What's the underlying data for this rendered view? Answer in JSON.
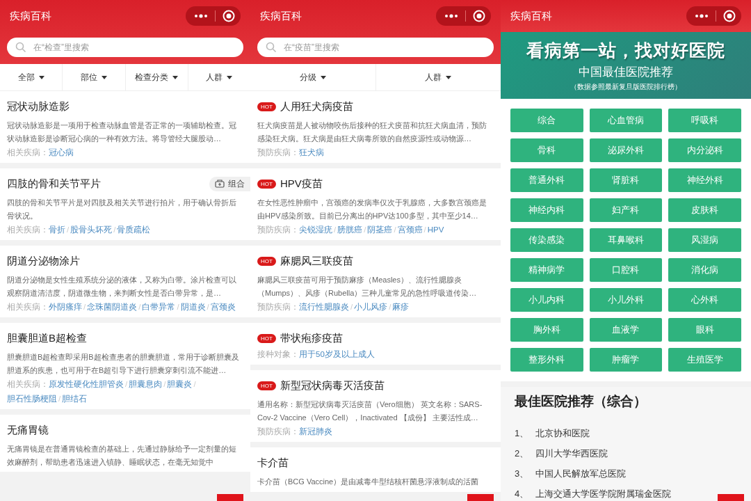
{
  "screens": [
    {
      "kind": "exams",
      "title": "疾病百科",
      "search": {
        "placeholder": "在“检查”里搜索"
      },
      "separator": "/",
      "filters": [
        {
          "label": "全部"
        },
        {
          "label": "部位"
        },
        {
          "label": "检查分类"
        },
        {
          "label": "人群"
        }
      ],
      "items": [
        {
          "title": "冠状动脉造影",
          "description": "冠状动脉造影是一项用于检查动脉血管是否正常的一项辅助检查。冠状动脉造影是诊断冠心病的一种有效方法。将导管经大腿股动…",
          "label": "相关疾病：",
          "related": [
            "冠心病"
          ]
        },
        {
          "title": "四肢的骨和关节平片",
          "tag": "组合",
          "description": "四肢的骨和关节平片是对四肢及相关关节进行拍片，用于确认骨折后骨状况。",
          "label": "相关疾病：",
          "related": [
            "骨折",
            "股骨头坏死",
            "骨质疏松"
          ]
        },
        {
          "title": "阴道分泌物涂片",
          "description": "阴道分泌物是女性生殖系统分泌的液体，又称为白带。涂片检查可以观察阴道清洁度，阴道微生物，来判断女性是否白带异常，是…",
          "label": "相关疾病：",
          "related": [
            "外阴瘙痒",
            "念珠菌阴道炎",
            "白带异常",
            "阴道炎",
            "宫颈炎"
          ]
        },
        {
          "title": "胆囊胆道B超检查",
          "description": "胆囊胆道B超检查即采用B超检查患者的胆囊胆道，常用于诊断胆囊及胆道系的疾患，也可用于在B超引导下进行胆囊穿刺引流不能进…",
          "label": "相关疾病：",
          "related": [
            "原发性硬化性胆管炎",
            "胆囊息肉",
            "胆囊炎",
            "胆石性肠梗阻",
            "胆结石"
          ]
        },
        {
          "title": "无痛胃镜",
          "description": "无痛胃镜是在普通胃镜检查的基础上，先通过静脉给予一定剂量的短效麻醉剂，帮助患者迅速进入镇静、睡眠状态，在毫无知觉中"
        }
      ]
    },
    {
      "kind": "vaccines",
      "title": "疾病百科",
      "search": {
        "placeholder": "在“疫苗”里搜索"
      },
      "separator": "/",
      "filters": [
        {
          "label": "分级"
        },
        {
          "label": "人群"
        }
      ],
      "items": [
        {
          "badge": "HOT",
          "title": "人用狂犬病疫苗",
          "description": "狂犬病疫苗是人被动物咬伤后接种的狂犬疫苗和抗狂犬病血清，预防感染狂犬病。狂犬病是由狂犬病毒所致的自然疫源性或动物源…",
          "label": "预防疾病：",
          "related": [
            "狂犬病"
          ]
        },
        {
          "badge": "HOT",
          "title": "HPV疫苗",
          "description": "在女性恶性肿瘤中，宫颈癌的发病率仅次于乳腺癌，大多数宫颈癌是由HPV感染所致。目前已分离出的HPV达100多型，其中至少14…",
          "label": "预防疾病：",
          "related": [
            "尖锐湿疣",
            "膀胱癌",
            "阴茎癌",
            "宫颈癌",
            "HPV"
          ]
        },
        {
          "badge": "HOT",
          "title": "麻腮风三联疫苗",
          "description": "麻腮风三联疫苗可用于预防麻疹（Measles）、流行性腮腺炎（Mumps）、风疹（Rubella）三种儿童常见的急性呼吸道传染…",
          "label": "预防疾病：",
          "related": [
            "流行性腮腺炎",
            "小儿风疹",
            "麻疹"
          ]
        },
        {
          "badge": "HOT",
          "title": "带状疱疹疫苗",
          "label": "接种对象：",
          "related": [
            "用于50岁及以上成人"
          ]
        },
        {
          "badge": "HOT",
          "title": "新型冠状病毒灭活疫苗",
          "description": "通用名称：新型冠状病毒灭活疫苗（Vero细胞） 英文名称：SARS-Cov-2 Vaccine（Vero Cell），Inactivated 【成份】 主要活性成…",
          "label": "预防疾病：",
          "related": [
            "新冠肺炎"
          ]
        },
        {
          "title": "卡介苗",
          "description": "卡介苗（BCG Vaccine）是由减毒牛型结核杆菌悬浮液制成的活菌"
        }
      ]
    },
    {
      "kind": "hospitals",
      "title": "疾病百科",
      "banner": {
        "headline": "看病第一站，找对好医院",
        "subtitle": "中国最佳医院推荐",
        "note": "（数据参照最新复旦版医院排行榜）"
      },
      "departments": [
        "综合",
        "心血管病",
        "呼吸科",
        "骨科",
        "泌尿外科",
        "内分泌科",
        "普通外科",
        "肾脏科",
        "神经外科",
        "神经内科",
        "妇产科",
        "皮肤科",
        "传染感染",
        "耳鼻喉科",
        "风湿病",
        "精神病学",
        "口腔科",
        "消化病",
        "小儿内科",
        "小儿外科",
        "心外科",
        "胸外科",
        "血液学",
        "眼科",
        "整形外科",
        "肿瘤学",
        "生殖医学"
      ],
      "ranking": {
        "title": "最佳医院推荐（综合）",
        "items": [
          {
            "number": "1、",
            "name": "北京协和医院"
          },
          {
            "number": "2、",
            "name": "四川大学华西医院"
          },
          {
            "number": "3、",
            "name": "中国人民解放军总医院"
          },
          {
            "number": "4、",
            "name": "上海交通大学医学院附属瑞金医院"
          }
        ]
      }
    }
  ]
}
